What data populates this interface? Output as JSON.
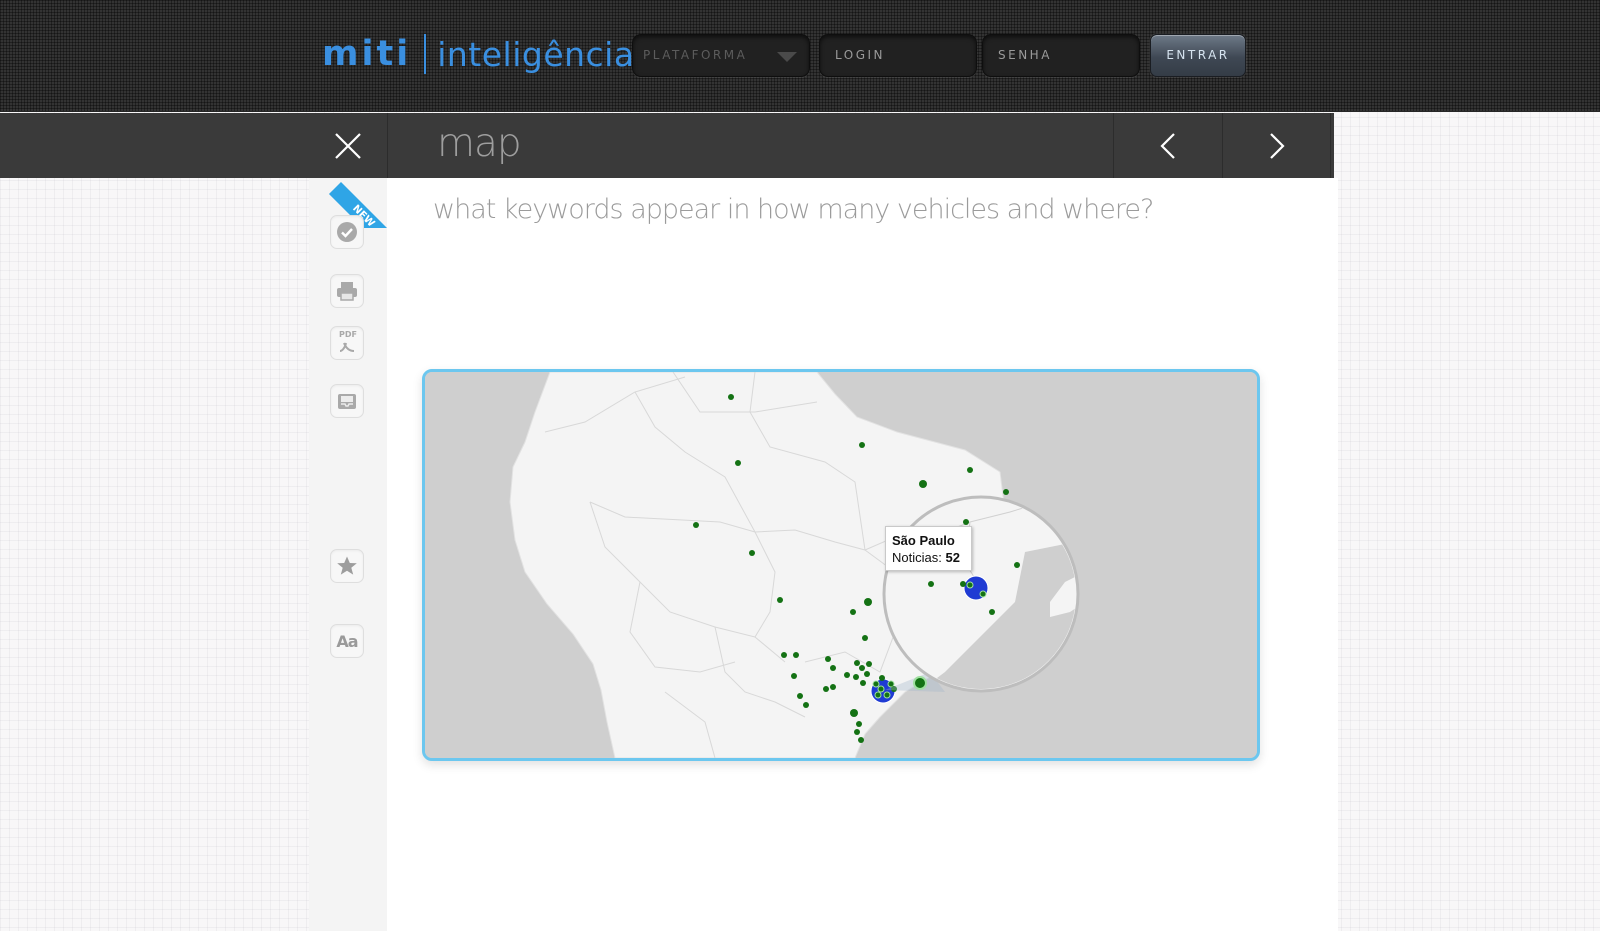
{
  "header": {
    "logo_bold": "miti",
    "logo_light": "inteligência",
    "platform_select": "PLATAFORMA",
    "login_placeholder": "LOGIN",
    "password_placeholder": "SENHA",
    "submit_label": "ENTRAR"
  },
  "titlebar": {
    "title": "map",
    "icons": {
      "close": "close-icon",
      "prev": "chevron-left-icon",
      "next": "chevron-right-icon"
    }
  },
  "toolbar": {
    "badge": "NEW",
    "items": [
      {
        "name": "check",
        "icon": "check-circle-icon"
      },
      {
        "name": "print",
        "icon": "printer-icon"
      },
      {
        "name": "pdf",
        "icon": "pdf-icon",
        "label": "PDF"
      },
      {
        "name": "archive",
        "icon": "inbox-icon"
      },
      {
        "name": "favorite",
        "icon": "star-icon"
      },
      {
        "name": "font",
        "icon": "font-size-icon",
        "label": "Aa"
      }
    ]
  },
  "main": {
    "question": "what keywords appear in how many vehicles and where?"
  },
  "map": {
    "tooltip": {
      "city": "São Paulo",
      "label": "Noticias:",
      "value": "52"
    },
    "colors": {
      "ocean": "#cfcfcf",
      "land": "#f4f4f4",
      "marker": "#147214",
      "cluster": "#1f3bd3",
      "frame": "#6cc7ef"
    }
  }
}
